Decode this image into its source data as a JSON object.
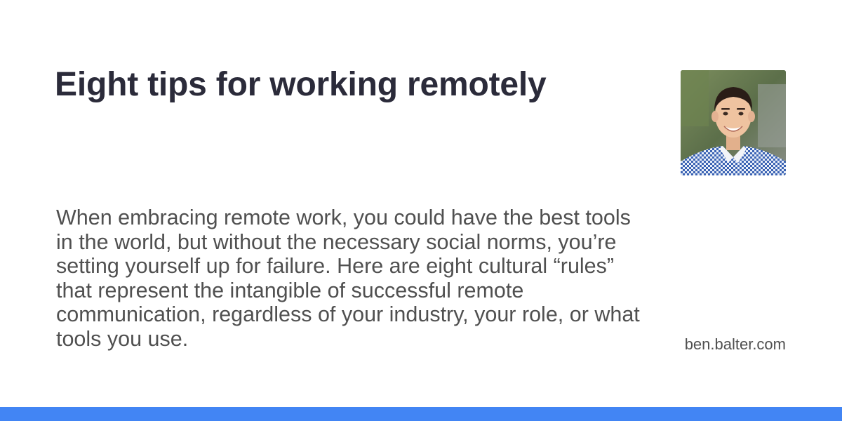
{
  "card": {
    "title": "Eight tips for working remotely",
    "description": "When embracing remote work, you could have the best tools in the world, but without the necessary social norms, you’re setting yourself up for failure. Here are eight cultural “rules” that represent the intangible of successful remote communication, regardless of your industry, your role, or what tools you use.",
    "site": "ben.balter.com",
    "avatar_icon": "author-photo",
    "accent_color": "#4285f4",
    "title_color": "#2b2b3a",
    "text_color": "#505050"
  }
}
